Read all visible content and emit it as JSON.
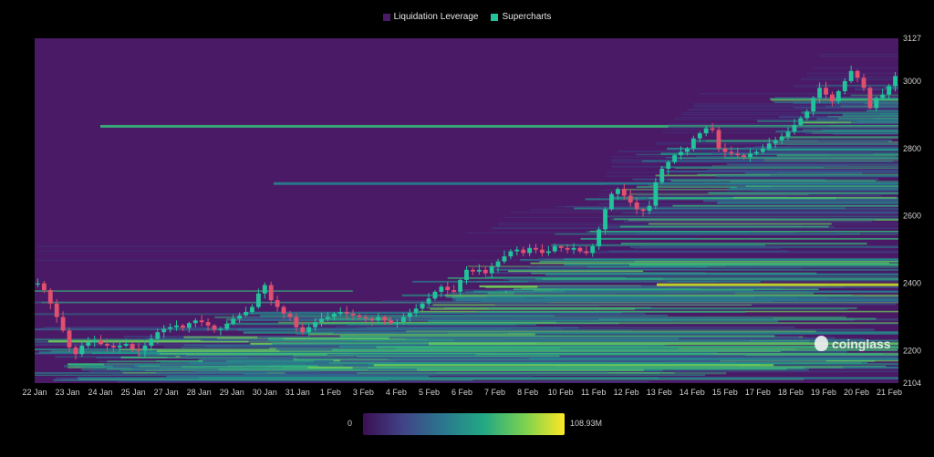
{
  "legend": {
    "items": [
      {
        "label": "Liquidation Leverage",
        "color": "#4b1a66"
      },
      {
        "label": "Supercharts",
        "color": "#22c39a"
      }
    ]
  },
  "watermark": {
    "text": "coinglass"
  },
  "colorbar": {
    "min_label": "0",
    "max_label": "108.93M",
    "colors": [
      "#3b0f54",
      "#414487",
      "#2a788e",
      "#22a884",
      "#7ad151",
      "#fde725"
    ]
  },
  "chart_data": {
    "type": "heatmap",
    "title": "",
    "x_ticks": [
      "22 Jan",
      "23 Jan",
      "24 Jan",
      "25 Jan",
      "27 Jan",
      "28 Jan",
      "29 Jan",
      "30 Jan",
      "31 Jan",
      "1 Feb",
      "3 Feb",
      "4 Feb",
      "5 Feb",
      "6 Feb",
      "7 Feb",
      "8 Feb",
      "10 Feb",
      "11 Feb",
      "12 Feb",
      "13 Feb",
      "14 Feb",
      "15 Feb",
      "17 Feb",
      "18 Feb",
      "19 Feb",
      "20 Feb",
      "21 Feb"
    ],
    "y_ticks": [
      3127,
      3000,
      2800,
      2600,
      2400,
      2200,
      2104
    ],
    "ylim": [
      2104,
      3127
    ],
    "background_color": "#4b1a66",
    "price_candles_close": [
      2400,
      2380,
      2340,
      2300,
      2260,
      2210,
      2190,
      2215,
      2225,
      2230,
      2220,
      2215,
      2210,
      2215,
      2220,
      2205,
      2200,
      2215,
      2235,
      2255,
      2265,
      2270,
      2275,
      2268,
      2282,
      2290,
      2285,
      2275,
      2262,
      2265,
      2280,
      2295,
      2305,
      2315,
      2330,
      2370,
      2395,
      2350,
      2330,
      2310,
      2300,
      2270,
      2255,
      2270,
      2285,
      2295,
      2300,
      2310,
      2315,
      2310,
      2305,
      2300,
      2295,
      2290,
      2300,
      2290,
      2282,
      2285,
      2300,
      2312,
      2325,
      2340,
      2355,
      2375,
      2390,
      2380,
      2375,
      2410,
      2440,
      2435,
      2440,
      2430,
      2450,
      2465,
      2480,
      2495,
      2500,
      2490,
      2505,
      2500,
      2490,
      2495,
      2510,
      2505,
      2500,
      2505,
      2495,
      2490,
      2510,
      2560,
      2620,
      2665,
      2680,
      2660,
      2640,
      2620,
      2615,
      2630,
      2700,
      2740,
      2760,
      2780,
      2790,
      2800,
      2830,
      2845,
      2860,
      2855,
      2800,
      2790,
      2785,
      2780,
      2775,
      2785,
      2790,
      2800,
      2815,
      2825,
      2835,
      2850,
      2870,
      2890,
      2910,
      2950,
      2980,
      2960,
      2940,
      2970,
      3000,
      3030,
      3010,
      2980,
      2920,
      2950,
      2960,
      2985,
      3015
    ]
  }
}
